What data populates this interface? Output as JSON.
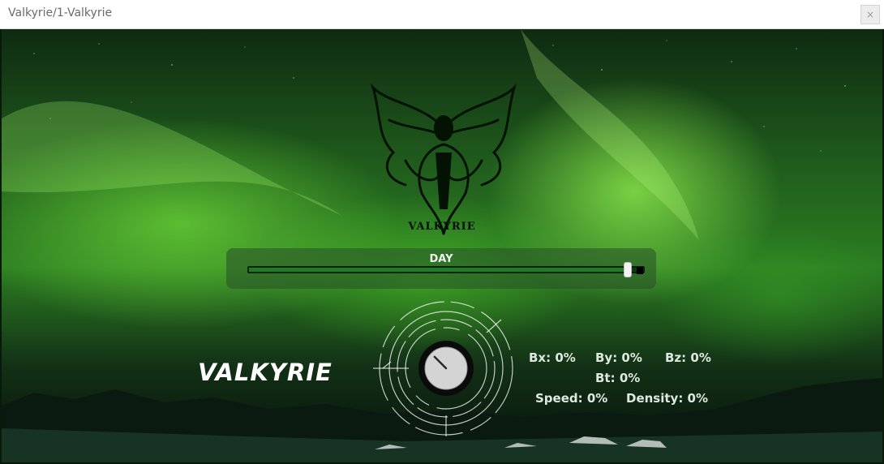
{
  "window": {
    "title": "Valkyrie/1-Valkyrie",
    "close_label": "×"
  },
  "emblem": {
    "wordmark": "VALKYRIE",
    "icon": "winged-valkyrie-emblem"
  },
  "day_slider": {
    "label": "DAY",
    "value_fraction": 0.96
  },
  "brand": {
    "text": "VALKYRIE"
  },
  "knob": {
    "icon": "mix-knob",
    "level_fraction": 0.0
  },
  "readouts": {
    "bx": "Bx: 0%",
    "by": "By: 0%",
    "bz": "Bz: 0%",
    "bt": "Bt: 0%",
    "speed": "Speed: 0%",
    "density": "Density: 0%"
  },
  "colors": {
    "aurora_green": "#56d42a",
    "panel": "#2a5a2a",
    "slider_track": "#0e3a12",
    "text": "#ffffff"
  }
}
